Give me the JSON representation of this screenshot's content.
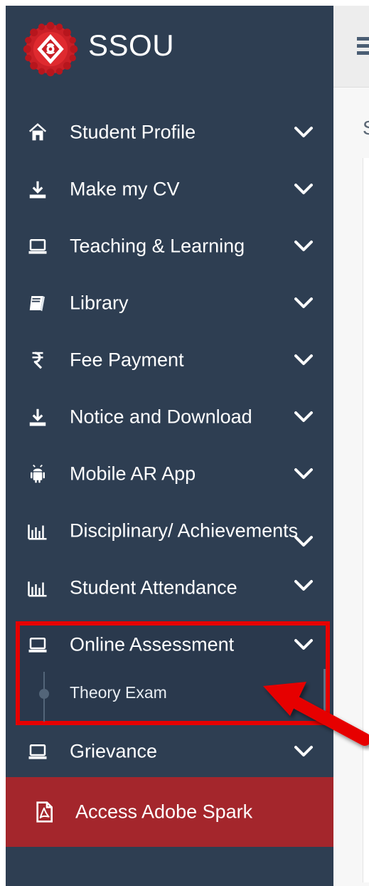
{
  "brand": {
    "name": "SSOU"
  },
  "content": {
    "partial_heading": "S"
  },
  "sidebar": {
    "items": [
      {
        "label": "Student Profile",
        "icon": "home-icon"
      },
      {
        "label": "Make my CV",
        "icon": "download-icon"
      },
      {
        "label": "Teaching & Learning",
        "icon": "laptop-icon"
      },
      {
        "label": "Library",
        "icon": "book-icon"
      },
      {
        "label": "Fee Payment",
        "icon": "rupee-icon"
      },
      {
        "label": "Notice and Download",
        "icon": "download-icon"
      },
      {
        "label": "Mobile AR App",
        "icon": "android-icon"
      },
      {
        "label": "Disciplinary/ Achievements",
        "icon": "bar-chart-icon"
      },
      {
        "label": "Student Attendance",
        "icon": "bar-chart-icon"
      },
      {
        "label": "Online Assessment",
        "icon": "laptop-icon",
        "subitems": [
          {
            "label": "Theory Exam"
          }
        ]
      },
      {
        "label": "Grievance",
        "icon": "laptop-icon"
      }
    ],
    "action_button": {
      "label": "Access Adobe Spark",
      "icon": "pdf-icon"
    }
  },
  "colors": {
    "sidebar": "#2e3e52",
    "accent_red": "#e60000",
    "action_button": "#a4262c",
    "text": "#ffffff"
  }
}
